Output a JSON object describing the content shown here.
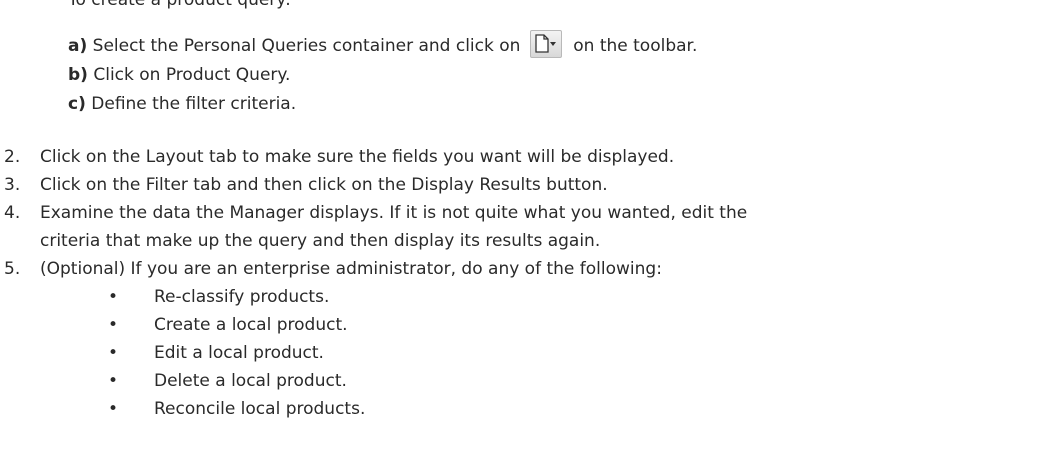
{
  "cut_line": "To create a product query:",
  "substeps": [
    {
      "letter": "a)",
      "before": "Select the Personal Queries container and click on",
      "icon": "new-document-dropdown-icon",
      "after": "on the toolbar."
    },
    {
      "letter": "b)",
      "text": "Click on Product Query."
    },
    {
      "letter": "c)",
      "text": "Define the filter criteria."
    }
  ],
  "steps": [
    {
      "num": "2.",
      "text": "Click on the Layout tab to make sure the fields you want will be displayed."
    },
    {
      "num": "3.",
      "text": "Click on the Filter tab and then click on the Display Results button."
    },
    {
      "num": "4.",
      "text": "Examine the data the Manager displays. If it is not quite what you wanted, edit the",
      "cont": "criteria that make up the query and then display its results again."
    },
    {
      "num": "5.",
      "text": "(Optional) If you are an enterprise administrator, do any of the following:"
    }
  ],
  "bullets": [
    "Re-classify products.",
    "Create a local product.",
    "Edit a local product.",
    "Delete a local product.",
    "Reconcile local products."
  ]
}
